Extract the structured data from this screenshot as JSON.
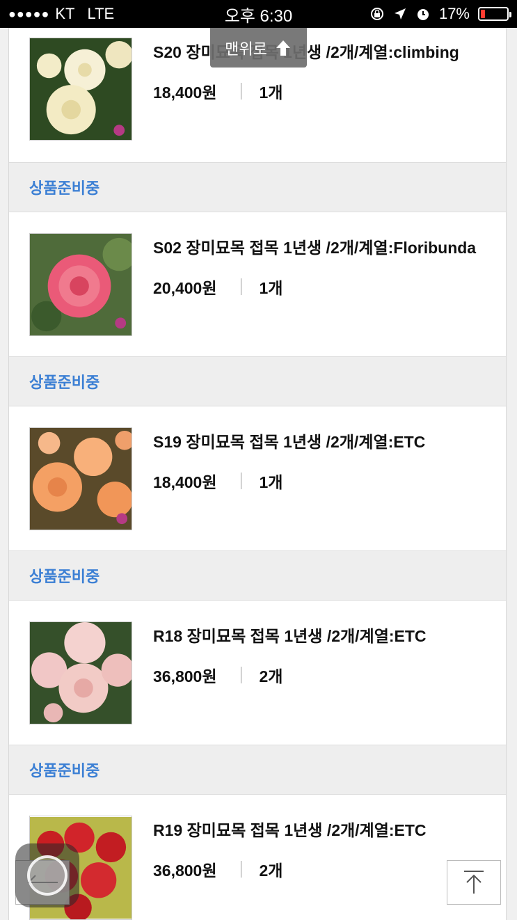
{
  "status_bar": {
    "carrier": "KT",
    "network": "LTE",
    "time": "오후 6:30",
    "battery_percent": "17%",
    "battery_level": 0.17
  },
  "tooltip": {
    "label": "맨위로"
  },
  "items": [
    {
      "title": "S20 장미묘목 접목 1년생 /2개/계열:climbing",
      "price": "18,400원",
      "qty": "1개",
      "status": "상품준비중",
      "image": "white-rose"
    },
    {
      "title": "S02 장미묘목 접목 1년생 /2개/계열:Floribunda",
      "price": "20,400원",
      "qty": "1개",
      "status": "상품준비중",
      "image": "pink-rose"
    },
    {
      "title": "S19 장미묘목 접목 1년생 /2개/계열:ETC",
      "price": "18,400원",
      "qty": "1개",
      "status": "상품준비중",
      "image": "peach-rose"
    },
    {
      "title": "R18 장미묘목 접목 1년생 /2개/계열:ETC",
      "price": "36,800원",
      "qty": "2개",
      "status": "상품준비중",
      "image": "light-pink-rose"
    },
    {
      "title": "R19 장미묘목 접목 1년생 /2개/계열:ETC",
      "price": "36,800원",
      "qty": "2개",
      "status": "",
      "image": "red-rose"
    }
  ],
  "colors": {
    "status_text": "#3b7fd4",
    "status_bg": "#eeeeee"
  }
}
